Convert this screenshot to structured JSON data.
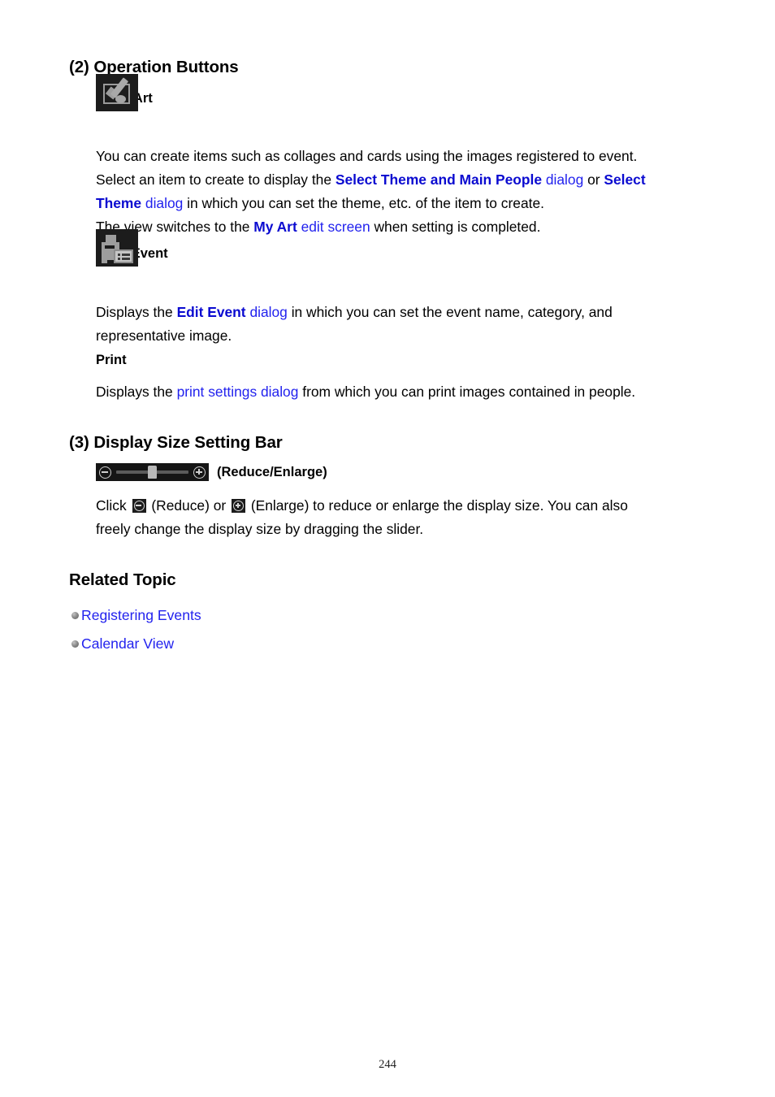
{
  "sections": {
    "operation_buttons": {
      "heading": "(2) Operation Buttons",
      "new_art": {
        "icon_name": "new-art-icon",
        "label": "New Art",
        "lines": {
          "l1": "You can create items such as collages and cards using the images registered to event.",
          "l2_a": "Select an item to create to display the ",
          "l2_b": "Select Theme and Main People",
          "l2_c": " dialog",
          "l2_d": " or ",
          "l2_e": "Select",
          "l3_a": "Theme",
          "l3_b": " dialog",
          "l3_c": " in which you can set the theme, etc. of the item to create.",
          "l4_a": "The view switches to the ",
          "l4_b": "My Art",
          "l4_c": " edit screen",
          "l4_d": " when setting is completed."
        }
      },
      "edit_event": {
        "icon_name": "edit-event-icon",
        "label": "Edit Event",
        "lines": {
          "l1_a": "Displays the ",
          "l1_b": "Edit Event",
          "l1_c": " dialog",
          "l1_d": " in which you can set the event name, category, and",
          "l2": "representative image."
        }
      },
      "print": {
        "label": "Print",
        "lines": {
          "l1_a": "Displays the ",
          "l1_b": "print settings dialog",
          "l1_c": " from which you can print images contained in people."
        }
      }
    },
    "display_size": {
      "heading": "(3) Display Size Setting Bar",
      "slider_caption": "(Reduce/Enlarge)",
      "reduce_icon_name": "reduce-icon",
      "enlarge_icon_name": "enlarge-icon",
      "lines": {
        "l1_a": "Click ",
        "l1_b": " (Reduce) or ",
        "l1_c": " (Enlarge) to reduce or enlarge the display size. You can also",
        "l2": "freely change the display size by dragging the slider."
      }
    },
    "related_topic": {
      "heading": "Related Topic",
      "items": [
        {
          "label": "Registering Events"
        },
        {
          "label": "Calendar View"
        }
      ]
    }
  },
  "footer": {
    "page_number": "244"
  },
  "colors": {
    "link_blue": "#2222ee",
    "bold_link_blue": "#0a0ad0",
    "icon_dark": "#1c1c1c",
    "icon_gray": "#9d9d9d"
  }
}
